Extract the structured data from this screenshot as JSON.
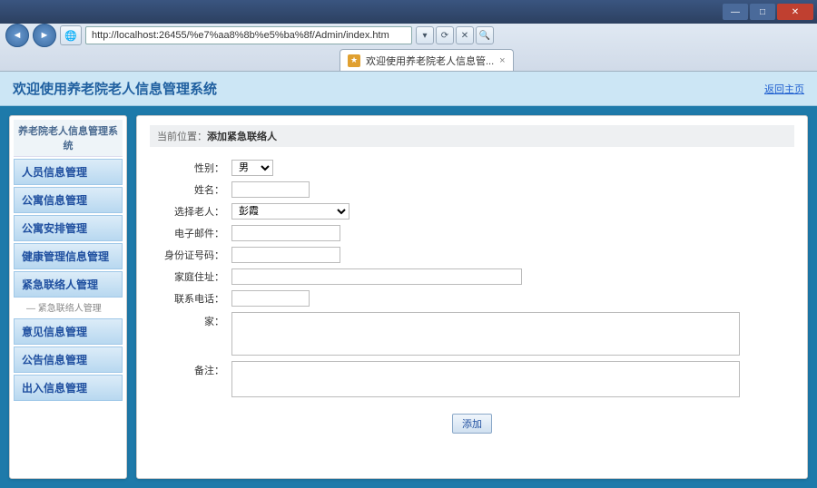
{
  "browser": {
    "url": "http://localhost:26455/%e7%aa8%8b%e5%ba%8f/Admin/index.htm",
    "tab_title": "欢迎使用养老院老人信息管...",
    "tab_close": "×",
    "win_min": "—",
    "win_max": "□",
    "win_close": "✕",
    "back": "◄",
    "fwd": "►",
    "refresh": "⟳",
    "stop": "✕",
    "search": "🔍"
  },
  "header": {
    "title": "欢迎使用养老院老人信息管理系统",
    "right_link": "返回主页"
  },
  "sidebar": {
    "title": "养老院老人信息管理系统",
    "items": [
      {
        "label": "人员信息管理"
      },
      {
        "label": "公寓信息管理"
      },
      {
        "label": "公寓安排管理"
      },
      {
        "label": "健康管理信息管理"
      },
      {
        "label": "紧急联络人管理",
        "sub": "— 紧急联络人管理"
      },
      {
        "label": "意见信息管理"
      },
      {
        "label": "公告信息管理"
      },
      {
        "label": "出入信息管理"
      }
    ]
  },
  "crumb": {
    "label": "当前位置：",
    "current": "添加紧急联络人"
  },
  "form": {
    "gender_label": "性别：",
    "gender_value": "男",
    "name_label": "姓名：",
    "name_value": "",
    "elder_label": "选择老人：",
    "elder_value": "彭霞",
    "email_label": "电子邮件：",
    "email_value": "",
    "idcard_label": "身份证号码：",
    "idcard_value": "",
    "address_label": "家庭住址：",
    "address_value": "",
    "phone_label": "联系电话：",
    "phone_value": "",
    "relation_label": "家：",
    "relation_value": "",
    "remark_label": "备注：",
    "remark_value": "",
    "submit": "添加"
  }
}
